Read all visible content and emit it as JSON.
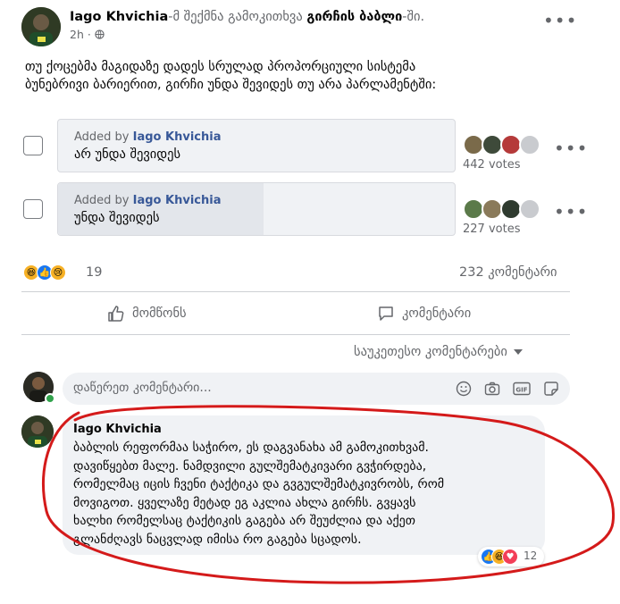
{
  "post": {
    "author": "Iago Khvichia",
    "action_text": "-მ შექმნა გამოკითხვა",
    "group": "გირჩის ბაბლი",
    "group_suffix": "-ში.",
    "time": "2h",
    "privacy_icon": "globe-icon",
    "body_line1": "თუ ქოცებმა მაგიდაზე  დადეს სრულად პროპორციული სისტემა",
    "body_line2": "ბუნებრივი ბარიერით, გირჩი უნდა შევიდეს თუ არა პარლამენტში:"
  },
  "poll": {
    "options": [
      {
        "added_by_prefix": "Added by",
        "added_by_name": "Iago Khvichia",
        "text": "არ უნდა შევიდეს",
        "votes": "442 votes"
      },
      {
        "added_by_prefix": "Added by",
        "added_by_name": "Iago Khvichia",
        "text": "უნდა შევიდეს",
        "votes": "227 votes"
      }
    ]
  },
  "stats": {
    "reaction_count": "19",
    "comment_count": "232 კომენტარი"
  },
  "actions": {
    "like": "მომწონს",
    "comment": "კომენტარი"
  },
  "sort": {
    "label": "საუკეთესო კომენტარები"
  },
  "composer": {
    "placeholder": "დაწერეთ კომენტარი..."
  },
  "comment": {
    "author": "Iago Khvichia",
    "lines": [
      "ბაბლის რეფორმაა საჭირო, ეს დაგვანახა ამ გამოკითხვამ.",
      "დავიწყებთ მალე. ნამდვილი გულშემატკივარი გვჭირდება,",
      "რომელმაც იცის ჩვენი ტაქტიკა და გვგულშემატკივრობს, რომ",
      "მოვიგოთ. ყველაზე მეტად ეგ აკლია ახლა გირჩს. გვყავს",
      "ხალხი რომელსაც ტაქტიკის გაგება არ შეუძლია და აქეთ",
      "გლანძღავს ნაცვლად იმისა რო გაგება სცადოს."
    ],
    "reaction_count": "12"
  },
  "colors": {
    "link_blue": "#385898",
    "annotation_red": "#d41a1a",
    "bubble_bg": "#f0f2f5"
  }
}
